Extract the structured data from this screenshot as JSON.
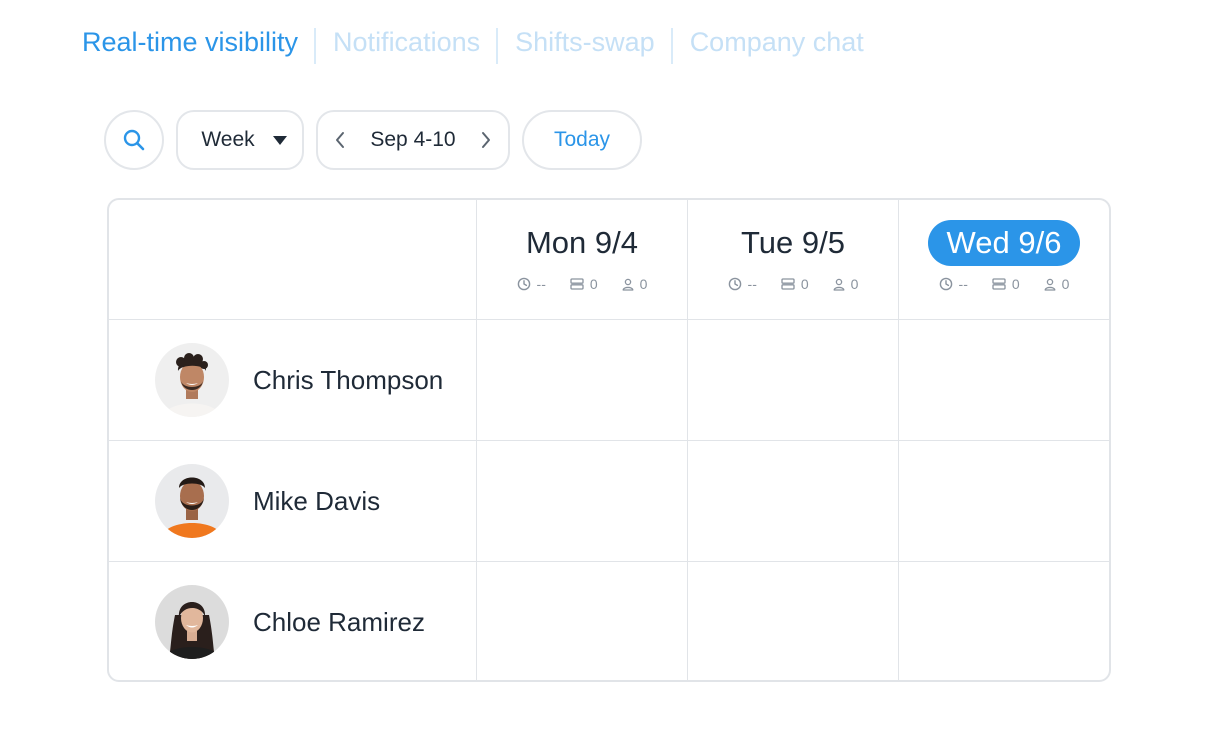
{
  "tabs": [
    {
      "label": "Real-time visibility",
      "active": true
    },
    {
      "label": "Notifications",
      "active": false
    },
    {
      "label": "Shifts-swap",
      "active": false
    },
    {
      "label": "Company chat",
      "active": false
    }
  ],
  "toolbar": {
    "search_icon": "search-icon",
    "view_label": "Week",
    "range_label": "Sep 4-10",
    "today_label": "Today"
  },
  "days": [
    {
      "label": "Mon 9/4",
      "hours": "--",
      "shifts": "0",
      "people": "0",
      "is_today": false
    },
    {
      "label": "Tue 9/5",
      "hours": "--",
      "shifts": "0",
      "people": "0",
      "is_today": false
    },
    {
      "label": "Wed 9/6",
      "hours": "--",
      "shifts": "0",
      "people": "0",
      "is_today": true
    }
  ],
  "employees": [
    {
      "name": "Chris Thompson"
    },
    {
      "name": "Mike Davis"
    },
    {
      "name": "Chloe Ramirez"
    }
  ],
  "colors": {
    "accent": "#2b95e8",
    "inactive_tab": "#c5e0f6",
    "border": "#e1e4e8",
    "text": "#1f2a37",
    "muted": "#8a939e"
  }
}
